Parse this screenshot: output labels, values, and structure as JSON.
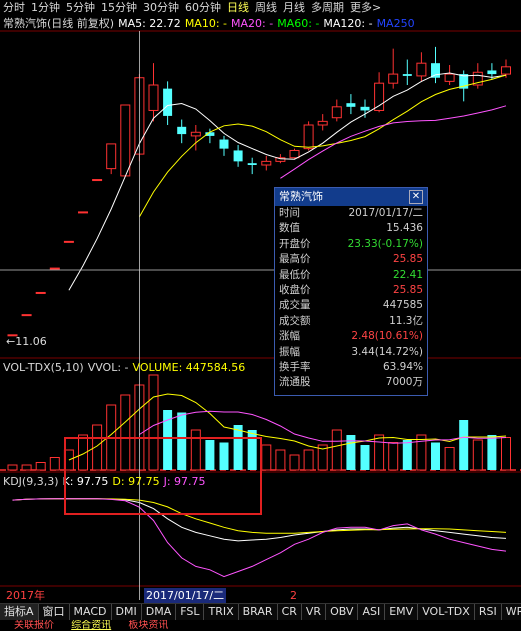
{
  "topbar": {
    "items": [
      "分时",
      "1分钟",
      "5分钟",
      "15分钟",
      "30分钟",
      "60分钟",
      "日线",
      "周线",
      "月线",
      "多周期",
      "更多>"
    ],
    "active": "日线"
  },
  "main_title": {
    "name": "常熟汽饰(日线 前复权)",
    "ma5": "MA5: 22.72",
    "ma10": "MA10: -",
    "ma20": "MA20: -",
    "ma60": "MA60: -",
    "ma120": "MA120: -",
    "ma250": "MA250",
    "low_marker": "←11.06"
  },
  "vol_title": {
    "name": "VOL-TDX(5,10)",
    "vvol": "VVOL: -",
    "volume": "VOLUME: 447584.56"
  },
  "kdj_title": {
    "name": "KDJ(9,3,3)",
    "k": "K: 97.75",
    "d": "D: 97.75",
    "j": "J: 97.75"
  },
  "popup": {
    "title": "常熟汽饰",
    "rows": [
      {
        "k": "时间",
        "v": "2017/01/17/二",
        "c": "#d0d0d0"
      },
      {
        "k": "数值",
        "v": "15.436",
        "c": "#d0d0d0"
      },
      {
        "k": "开盘价",
        "v": "23.33(-0.17%)",
        "c": "#33dd33"
      },
      {
        "k": "最高价",
        "v": "25.85",
        "c": "#ff4444"
      },
      {
        "k": "最低价",
        "v": "22.41",
        "c": "#33dd33"
      },
      {
        "k": "收盘价",
        "v": "25.85",
        "c": "#ff4444"
      },
      {
        "k": "成交量",
        "v": "447585",
        "c": "#d0d0d0"
      },
      {
        "k": "成交额",
        "v": "11.3亿",
        "c": "#d0d0d0"
      },
      {
        "k": "涨幅",
        "v": "2.48(10.61%)",
        "c": "#ff4444"
      },
      {
        "k": "振幅",
        "v": "3.44(14.72%)",
        "c": "#d0d0d0"
      },
      {
        "k": "换手率",
        "v": "63.94%",
        "c": "#d0d0d0"
      },
      {
        "k": "流通股",
        "v": "7000万",
        "c": "#d0d0d0"
      }
    ]
  },
  "date_axis": {
    "year": "2017年",
    "cursor_date": "2017/01/17/二",
    "mark2": "2"
  },
  "bottom_tabs": [
    "指标A",
    "窗口",
    "MACD",
    "DMI",
    "DMA",
    "FSL",
    "TRIX",
    "BRAR",
    "CR",
    "VR",
    "OBV",
    "ASI",
    "EMV",
    "VOL-TDX",
    "RSI",
    "WR"
  ],
  "ticker": {
    "a": "关联报价",
    "b": "综合资讯",
    "c": "板块资讯"
  },
  "colors": {
    "up": "#ff3232",
    "down": "#54ffff",
    "ma5": "#ffffff",
    "ma10": "#ffff00",
    "ma20": "#ff55ff",
    "ma60": "#00ff00",
    "ma120": "#ffffff",
    "ma250": "#2244ff"
  },
  "candles": [
    {
      "o": 11.06,
      "c": 11.06,
      "h": 11.06,
      "l": 11.06
    },
    {
      "o": 12.17,
      "c": 12.17,
      "h": 12.17,
      "l": 12.17
    },
    {
      "o": 13.39,
      "c": 13.39,
      "h": 13.39,
      "l": 13.39
    },
    {
      "o": 14.73,
      "c": 14.73,
      "h": 14.73,
      "l": 14.73
    },
    {
      "o": 16.2,
      "c": 16.2,
      "h": 16.2,
      "l": 16.2
    },
    {
      "o": 17.82,
      "c": 17.82,
      "h": 17.82,
      "l": 17.82
    },
    {
      "o": 19.6,
      "c": 19.6,
      "h": 19.6,
      "l": 19.6
    },
    {
      "o": 20.2,
      "c": 21.56,
      "h": 21.56,
      "l": 19.9
    },
    {
      "o": 19.8,
      "c": 23.7,
      "h": 23.7,
      "l": 19.8
    },
    {
      "o": 21.0,
      "c": 25.2,
      "h": 25.4,
      "l": 20.6
    },
    {
      "o": 23.4,
      "c": 24.8,
      "h": 26.0,
      "l": 22.8
    },
    {
      "o": 24.6,
      "c": 23.1,
      "h": 25.0,
      "l": 22.6
    },
    {
      "o": 22.5,
      "c": 22.1,
      "h": 22.9,
      "l": 21.6
    },
    {
      "o": 22.0,
      "c": 22.2,
      "h": 22.6,
      "l": 21.2
    },
    {
      "o": 22.2,
      "c": 22.0,
      "h": 22.4,
      "l": 21.6
    },
    {
      "o": 21.8,
      "c": 21.3,
      "h": 22.0,
      "l": 20.9
    },
    {
      "o": 21.2,
      "c": 20.6,
      "h": 21.5,
      "l": 20.3
    },
    {
      "o": 20.5,
      "c": 20.4,
      "h": 20.8,
      "l": 19.9
    },
    {
      "o": 20.4,
      "c": 20.6,
      "h": 20.9,
      "l": 20.1
    },
    {
      "o": 20.6,
      "c": 20.8,
      "h": 21.0,
      "l": 20.5
    },
    {
      "o": 20.8,
      "c": 21.2,
      "h": 21.3,
      "l": 20.7
    },
    {
      "o": 21.3,
      "c": 22.6,
      "h": 22.8,
      "l": 21.2
    },
    {
      "o": 22.6,
      "c": 22.8,
      "h": 23.2,
      "l": 22.3
    },
    {
      "o": 23.0,
      "c": 23.6,
      "h": 24.0,
      "l": 22.8
    },
    {
      "o": 23.8,
      "c": 23.6,
      "h": 24.3,
      "l": 23.2
    },
    {
      "o": 23.6,
      "c": 23.4,
      "h": 24.0,
      "l": 23.0
    },
    {
      "o": 23.4,
      "c": 24.9,
      "h": 25.5,
      "l": 23.3
    },
    {
      "o": 24.9,
      "c": 25.4,
      "h": 26.8,
      "l": 24.6
    },
    {
      "o": 25.4,
      "c": 25.3,
      "h": 26.2,
      "l": 24.8
    },
    {
      "o": 25.3,
      "c": 26.0,
      "h": 26.6,
      "l": 25.0
    },
    {
      "o": 26.0,
      "c": 25.2,
      "h": 26.9,
      "l": 24.9
    },
    {
      "o": 25.0,
      "c": 25.4,
      "h": 25.9,
      "l": 24.8
    },
    {
      "o": 25.4,
      "c": 24.6,
      "h": 25.6,
      "l": 23.9
    },
    {
      "o": 24.8,
      "c": 25.5,
      "h": 26.0,
      "l": 24.6
    },
    {
      "o": 25.6,
      "c": 25.4,
      "h": 26.0,
      "l": 25.1
    },
    {
      "o": 25.4,
      "c": 25.8,
      "h": 26.2,
      "l": 25.2
    }
  ],
  "volumes": [
    2,
    2,
    3,
    5,
    8,
    14,
    18,
    26,
    30,
    34,
    38,
    24,
    23,
    16,
    12,
    11,
    18,
    16,
    10,
    8,
    6,
    8,
    10,
    16,
    14,
    10,
    14,
    11,
    12,
    14,
    11,
    9,
    20,
    12,
    14,
    13
  ],
  "kdj": {
    "k": [
      97,
      97.5,
      97.7,
      97.75,
      97.75,
      97.75,
      97.75,
      97.6,
      97.2,
      95.6,
      92,
      86,
      81,
      78,
      76,
      74,
      73,
      73.5,
      74,
      75,
      76.5,
      77.5,
      78.5,
      79.5,
      80,
      80,
      79.5,
      80.5,
      81,
      80,
      79,
      78,
      77,
      76,
      75,
      74.5
    ],
    "d": [
      97,
      97.5,
      97.7,
      97.75,
      97.75,
      97.75,
      97.75,
      97.7,
      97.5,
      97,
      95.6,
      93,
      89,
      86,
      83.5,
      81,
      79,
      78,
      77.5,
      77.5,
      77.5,
      78,
      78.5,
      79,
      79.3,
      79.6,
      79.6,
      79.8,
      80,
      80.2,
      80.2,
      80,
      79.5,
      79,
      78.5,
      78
    ],
    "j": [
      97,
      97.5,
      97.7,
      97.75,
      97.75,
      97.75,
      97.75,
      97.4,
      96.6,
      92.8,
      85,
      72,
      63,
      58,
      56,
      52,
      55,
      58,
      62,
      66,
      71,
      74,
      78,
      80.5,
      81,
      81,
      79.4,
      82,
      83,
      79.5,
      77,
      74,
      72,
      70,
      68,
      67
    ]
  }
}
